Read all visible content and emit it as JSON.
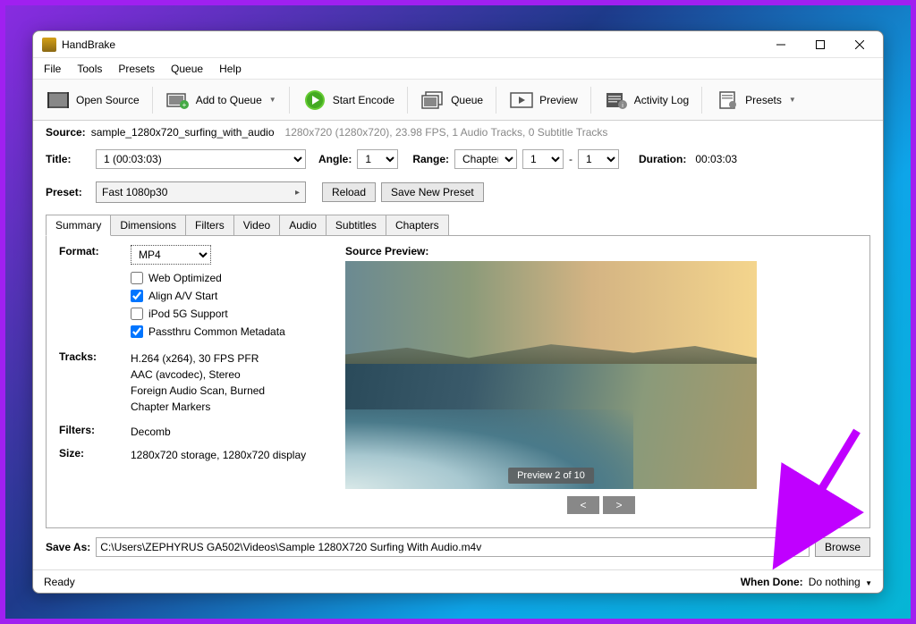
{
  "window": {
    "title": "HandBrake"
  },
  "menu": [
    "File",
    "Tools",
    "Presets",
    "Queue",
    "Help"
  ],
  "toolbar": {
    "open_source": "Open Source",
    "add_queue": "Add to Queue",
    "start_encode": "Start Encode",
    "queue": "Queue",
    "preview": "Preview",
    "activity_log": "Activity Log",
    "presets": "Presets"
  },
  "source": {
    "label": "Source:",
    "name": "sample_1280x720_surfing_with_audio",
    "details": "1280x720 (1280x720), 23.98 FPS, 1 Audio Tracks, 0 Subtitle Tracks"
  },
  "title": {
    "label": "Title:",
    "value": "1 (00:03:03)",
    "angle_label": "Angle:",
    "angle": "1",
    "range_label": "Range:",
    "range_type": "Chapters",
    "range_from": "1",
    "range_sep": "-",
    "range_to": "1",
    "duration_label": "Duration:",
    "duration": "00:03:03"
  },
  "preset": {
    "label": "Preset:",
    "value": "Fast 1080p30",
    "reload": "Reload",
    "save_new": "Save New Preset"
  },
  "tabs": [
    "Summary",
    "Dimensions",
    "Filters",
    "Video",
    "Audio",
    "Subtitles",
    "Chapters"
  ],
  "summary": {
    "format_label": "Format:",
    "format": "MP4",
    "opts": {
      "web_opt": {
        "label": "Web Optimized",
        "checked": false
      },
      "align_av": {
        "label": "Align A/V Start",
        "checked": true
      },
      "ipod": {
        "label": "iPod 5G Support",
        "checked": false
      },
      "passthru": {
        "label": "Passthru Common Metadata",
        "checked": true
      }
    },
    "tracks_label": "Tracks:",
    "tracks": [
      "H.264 (x264), 30 FPS PFR",
      "AAC (avcodec), Stereo",
      "Foreign Audio Scan, Burned",
      "Chapter Markers"
    ],
    "filters_label": "Filters:",
    "filters": "Decomb",
    "size_label": "Size:",
    "size": "1280x720 storage, 1280x720 display",
    "preview_label": "Source Preview:",
    "preview_caption": "Preview 2 of 10",
    "nav_prev": "<",
    "nav_next": ">"
  },
  "saveas": {
    "label": "Save As:",
    "path": "C:\\Users\\ZEPHYRUS GA502\\Videos\\Sample 1280X720 Surfing With Audio.m4v",
    "browse": "Browse"
  },
  "status": {
    "ready": "Ready",
    "when_done_label": "When Done:",
    "when_done": "Do nothing"
  }
}
